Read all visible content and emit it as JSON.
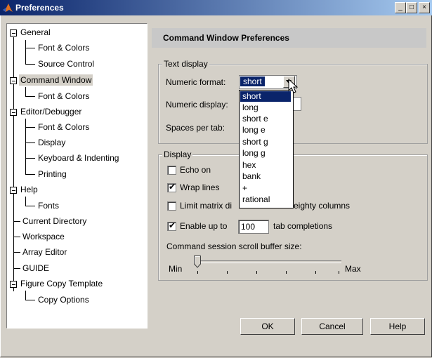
{
  "window": {
    "title": "Preferences",
    "controls": [
      "_",
      "□",
      "×"
    ]
  },
  "tree": {
    "items": [
      {
        "label": "General"
      },
      {
        "label": "Font & Colors"
      },
      {
        "label": "Source Control"
      },
      {
        "label": "Command Window"
      },
      {
        "label": "Font & Colors"
      },
      {
        "label": "Editor/Debugger"
      },
      {
        "label": "Font & Colors"
      },
      {
        "label": "Display"
      },
      {
        "label": "Keyboard & Indenting"
      },
      {
        "label": "Printing"
      },
      {
        "label": "Help"
      },
      {
        "label": "Fonts"
      },
      {
        "label": "Current Directory"
      },
      {
        "label": "Workspace"
      },
      {
        "label": "Array Editor"
      },
      {
        "label": "GUIDE"
      },
      {
        "label": "Figure Copy Template"
      },
      {
        "label": "Copy Options"
      }
    ],
    "selected": "Command Window"
  },
  "panel": {
    "title": "Command Window Preferences",
    "text_display": {
      "legend": "Text display",
      "numeric_format_label": "Numeric format:",
      "numeric_format_value": "short",
      "numeric_display_label": "Numeric display:",
      "spaces_per_tab_label": "Spaces per tab:",
      "format_options": [
        "short",
        "long",
        "short e",
        "long e",
        "short g",
        "long g",
        "hex",
        "bank",
        "+",
        "rational"
      ]
    },
    "display": {
      "legend": "Display",
      "echo_on": {
        "label": "Echo on",
        "checked": false
      },
      "wrap_lines": {
        "label": "Wrap lines",
        "checked": true
      },
      "limit_matrix": {
        "label": "Limit matrix display width to eighty columns",
        "visible_parts": [
          "Limit matrix di",
          "eighty columns"
        ],
        "checked": false
      },
      "enable_tab": {
        "label_pre": "Enable up to",
        "value": "100",
        "label_post": "tab completions",
        "checked": true
      },
      "scroll_buffer_label": "Command session scroll buffer size:",
      "slider": {
        "min_label": "Min",
        "max_label": "Max",
        "position_fraction": 0.0
      }
    }
  },
  "buttons": {
    "ok": "OK",
    "cancel": "Cancel",
    "help": "Help"
  },
  "colors": {
    "selection": "#0a246a",
    "face": "#d4d0c8",
    "header": "#c8c8c8"
  }
}
